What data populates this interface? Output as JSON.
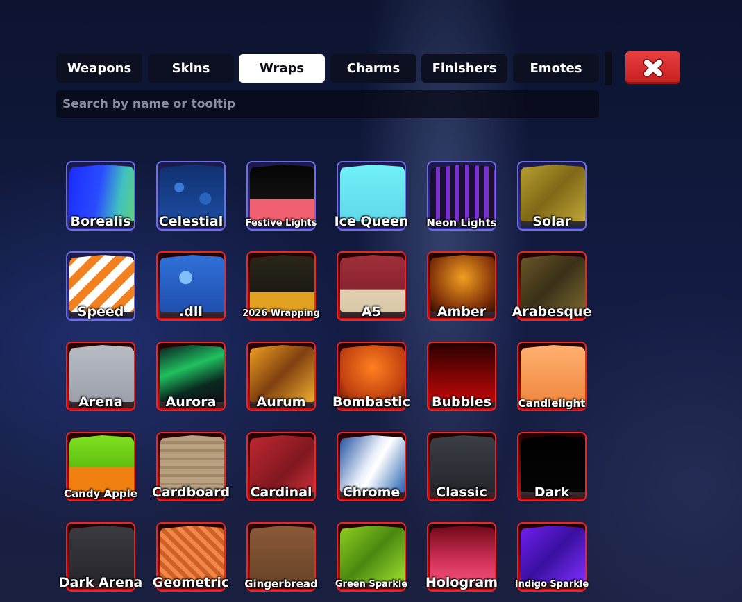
{
  "tabs": [
    {
      "label": "Weapons",
      "active": false
    },
    {
      "label": "Skins",
      "active": false
    },
    {
      "label": "Wraps",
      "active": true
    },
    {
      "label": "Charms",
      "active": false
    },
    {
      "label": "Finishers",
      "active": false
    },
    {
      "label": "Emotes",
      "active": false
    }
  ],
  "search": {
    "placeholder": "Search by name or tooltip",
    "value": ""
  },
  "close_icon": "close-x-icon",
  "colors": {
    "rarity_blue": "#6e6ee8",
    "rarity_red": "#f02424",
    "close_red": "#d42a2a",
    "active_tab": "#ffffff"
  },
  "wraps": [
    {
      "name": "Borealis",
      "rarity": "blue",
      "swatch": "linear-gradient(100deg,#1a2cff 0%,#2a4cff 45%,#40c0c0 75%,#60d080 100%)"
    },
    {
      "name": "Celestial",
      "rarity": "blue",
      "swatch": "radial-gradient(circle at 30% 40%,#3a7ad8 0 8%,transparent 9%),radial-gradient(circle at 70% 60%,#2a64c0 0 10%,transparent 11%),linear-gradient(180deg,#103070,#1c4ca0)"
    },
    {
      "name": "Festive Lights",
      "rarity": "blue",
      "swatch": "linear-gradient(180deg,#050505 0%,#111 60%,#f06070 61%,#f06070 100%)"
    },
    {
      "name": "Ice Queen",
      "rarity": "blue",
      "swatch": "linear-gradient(180deg,#70f0f8,#60d8e8)"
    },
    {
      "name": "Neon Lights",
      "rarity": "blue",
      "swatch": "repeating-linear-gradient(90deg,#1a1030 0 8px,#7a30d0 8px 14px)"
    },
    {
      "name": "Solar",
      "rarity": "blue",
      "swatch": "linear-gradient(135deg,#b8a030,#806818 50%,#c0a838)"
    },
    {
      "name": "Speed",
      "rarity": "blue",
      "swatch": "repeating-linear-gradient(135deg,#f08020 0 12px,#ffffff 12px 24px)"
    },
    {
      "name": ".dll",
      "rarity": "red",
      "swatch": "radial-gradient(circle at 40% 40%,#80c0f8 0 12%,transparent 13%),linear-gradient(180deg,#3070d8,#2050b0)"
    },
    {
      "name": "2026 Wrapping",
      "rarity": "red",
      "swatch": "linear-gradient(180deg,#2a2618 0%,#1c1a14 65%,#e0a020 66%,#e0a020 100%)"
    },
    {
      "name": "A5",
      "rarity": "red",
      "swatch": "linear-gradient(180deg,#a0303a 0%,#8a2430 60%,#e0d0b0 61%,#d8c8a8 100%)"
    },
    {
      "name": "Amber",
      "rarity": "red",
      "swatch": "radial-gradient(circle at 50% 40%,#f0a020,#803008 70%,#301000)"
    },
    {
      "name": "Arabesque",
      "rarity": "red",
      "swatch": "linear-gradient(135deg,#6a5828,#3a3018 50%,#7a6830)"
    },
    {
      "name": "Arena",
      "rarity": "red",
      "swatch": "linear-gradient(180deg,#b8bcc4,#9ca0aa)"
    },
    {
      "name": "Aurora",
      "rarity": "red",
      "swatch": "linear-gradient(160deg,#0a1a20 0%,#20c060 40%,#0a2a20 70%,#101018 100%)"
    },
    {
      "name": "Aurum",
      "rarity": "red",
      "swatch": "linear-gradient(135deg,#f0a020,#804010 50%,#f0b030)"
    },
    {
      "name": "Bombastic",
      "rarity": "red",
      "swatch": "radial-gradient(circle at 50% 40%,#ff8020,#c04010 70%,#602008)"
    },
    {
      "name": "Bubbles",
      "rarity": "red",
      "swatch": "linear-gradient(180deg,#300000,#c00808)"
    },
    {
      "name": "Candlelight",
      "rarity": "red",
      "swatch": "linear-gradient(180deg,#ffb070,#f08840)"
    },
    {
      "name": "Candy Apple",
      "rarity": "red",
      "swatch": "linear-gradient(180deg,#80e020 0%,#60c010 55%,#f08010 56%,#f08010 100%)"
    },
    {
      "name": "Cardboard",
      "rarity": "red",
      "swatch": "repeating-linear-gradient(180deg,#b8a080 0 8px,#a08868 8px 12px)"
    },
    {
      "name": "Cardinal",
      "rarity": "red",
      "swatch": "linear-gradient(135deg,#c02830,#801820 60%,#d03038)"
    },
    {
      "name": "Chrome",
      "rarity": "red",
      "swatch": "linear-gradient(120deg,#2050a0 0%,#e8eef8 45%,#ffffff 55%,#2060b0 100%)"
    },
    {
      "name": "Classic",
      "rarity": "red",
      "swatch": "linear-gradient(180deg,#3a3e46,#24262c)"
    },
    {
      "name": "Dark",
      "rarity": "red",
      "swatch": "linear-gradient(180deg,#000,#050505)"
    },
    {
      "name": "Dark Arena",
      "rarity": "red",
      "swatch": "linear-gradient(180deg,#3a3a40,#26262c)"
    },
    {
      "name": "Geometric",
      "rarity": "red",
      "swatch": "repeating-linear-gradient(45deg,#f08848 0 6px,#d06028 6px 12px)"
    },
    {
      "name": "Gingerbread",
      "rarity": "red",
      "swatch": "linear-gradient(180deg,#8a5a38,#6a4428)"
    },
    {
      "name": "Green Sparkle",
      "rarity": "red",
      "swatch": "linear-gradient(135deg,#90d020,#4a8810 50%,#a0e030)"
    },
    {
      "name": "Hologram",
      "rarity": "red",
      "swatch": "linear-gradient(180deg,#700818 0%,#d03058 60%,#f05078 100%)"
    },
    {
      "name": "Indigo Sparkle",
      "rarity": "red",
      "swatch": "linear-gradient(135deg,#7020f0,#3a10a0 50%,#8030ff)"
    }
  ]
}
